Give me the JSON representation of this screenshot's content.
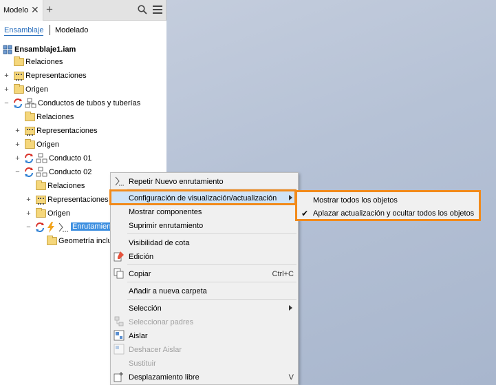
{
  "panel": {
    "tab_label": "Modelo",
    "close_glyph": "✕",
    "add_glyph": "+",
    "subtabs": {
      "ensamblaje": "Ensamblaje",
      "modelado": "Modelado"
    }
  },
  "tree": {
    "root": "Ensamblaje1.iam",
    "relaciones_1": "Relaciones",
    "representaciones_1": "Representaciones",
    "origen_1": "Origen",
    "conductos": "Conductos de tubos y tuberías",
    "relaciones_2": "Relaciones",
    "representaciones_2": "Representaciones",
    "origen_2": "Origen",
    "conducto01": "Conducto 01",
    "conducto02": "Conducto 02",
    "relaciones_3": "Relaciones",
    "representaciones_3": "Representaciones",
    "origen_3": "Origen",
    "enrutamiento": "Enrutamient",
    "geometria": "Geometría incluid"
  },
  "context_menu": {
    "repetir": "Repetir Nuevo enrutamiento",
    "config": "Configuración de visualización/actualización",
    "mostrar": "Mostrar componentes",
    "suprimir": "Suprimir enrutamiento",
    "visibilidad": "Visibilidad de cota",
    "edicion": "Edición",
    "copiar": "Copiar",
    "copiar_sc": "Ctrl+C",
    "anadir": "Añadir a nueva carpeta",
    "seleccion": "Selección",
    "seleccionar_padres": "Seleccionar padres",
    "aislar": "Aislar",
    "deshacer_aislar": "Deshacer Aislar",
    "sustituir": "Sustituir",
    "desplazamiento": "Desplazamiento libre",
    "desplazamiento_sc": "V"
  },
  "submenu": {
    "mostrar_todos": "Mostrar todos los objetos",
    "aplazar": "Aplazar actualización y ocultar todos los objetos",
    "check": "✔"
  },
  "colors": {
    "highlight_border": "#f28a1a",
    "selection": "#3d8fe0",
    "tab_accent": "#2a6fbd"
  }
}
